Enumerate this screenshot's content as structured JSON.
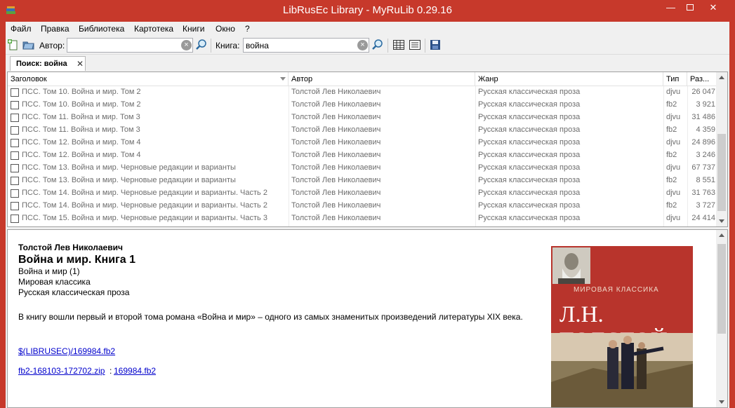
{
  "window": {
    "title": "LibRusEc Library - MyRuLib 0.29.16",
    "minimize_glyph": "—",
    "close_glyph": "✕"
  },
  "menu": [
    "Файл",
    "Правка",
    "Библиотека",
    "Картотека",
    "Книги",
    "Окно",
    "?"
  ],
  "toolbar": {
    "author_label": "Автор:",
    "author_value": "",
    "book_label": "Книга:",
    "book_value": "война",
    "clear_glyph": "×"
  },
  "tab": {
    "label": "Поиск: война",
    "close_glyph": "✕"
  },
  "columns": [
    "Заголовок",
    "Автор",
    "Жанр",
    "Тип",
    "Раз..."
  ],
  "rows": [
    {
      "title": "ПСС. Том 10. Война и мир. Том 2",
      "author": "Толстой Лев Николаевич",
      "genre": "Русская классическая проза",
      "type": "djvu",
      "size": "26 047"
    },
    {
      "title": "ПСС. Том 10. Война и мир. Том 2",
      "author": "Толстой Лев Николаевич",
      "genre": "Русская классическая проза",
      "type": "fb2",
      "size": "3 921"
    },
    {
      "title": "ПСС. Том 11. Война и мир. Том 3",
      "author": "Толстой Лев Николаевич",
      "genre": "Русская классическая проза",
      "type": "djvu",
      "size": "31 486"
    },
    {
      "title": "ПСС. Том 11. Война и мир. Том 3",
      "author": "Толстой Лев Николаевич",
      "genre": "Русская классическая проза",
      "type": "fb2",
      "size": "4 359"
    },
    {
      "title": "ПСС. Том 12. Война и мир. Том 4",
      "author": "Толстой Лев Николаевич",
      "genre": "Русская классическая проза",
      "type": "djvu",
      "size": "24 896"
    },
    {
      "title": "ПСС. Том 12. Война и мир. Том 4",
      "author": "Толстой Лев Николаевич",
      "genre": "Русская классическая проза",
      "type": "fb2",
      "size": "3 246"
    },
    {
      "title": "ПСС. Том 13. Война и мир. Черновые редакции и варианты",
      "author": "Толстой Лев Николаевич",
      "genre": "Русская классическая проза",
      "type": "djvu",
      "size": "67 737"
    },
    {
      "title": "ПСС. Том 13. Война и мир. Черновые редакции и варианты",
      "author": "Толстой Лев Николаевич",
      "genre": "Русская классическая проза",
      "type": "fb2",
      "size": "8 551"
    },
    {
      "title": "ПСС. Том 14. Война и мир. Черновые редакции и варианты. Часть 2",
      "author": "Толстой Лев Николаевич",
      "genre": "Русская классическая проза",
      "type": "djvu",
      "size": "31 763"
    },
    {
      "title": "ПСС. Том 14. Война и мир. Черновые редакции и варианты. Часть 2",
      "author": "Толстой Лев Николаевич",
      "genre": "Русская классическая проза",
      "type": "fb2",
      "size": "3 727"
    },
    {
      "title": "ПСС. Том 15. Война и мир. Черновые редакции и варианты. Часть 3",
      "author": "Толстой Лев Николаевич",
      "genre": "Русская классическая проза",
      "type": "djvu",
      "size": "24 414"
    }
  ],
  "detail": {
    "author": "Толстой Лев Николаевич",
    "title": "Война и мир. Книга 1",
    "series": "Война и мир (1)",
    "collection": "Мировая классика",
    "genre": "Русская классическая проза",
    "description": "В книгу вошли первый и второй тома романа «Война и мир» – одного из самых знаменитых произведений литературы XIX века.",
    "link_path": "$(LIBRUSEC)/169984.fb2",
    "archive": "fb2-168103-172702.zip",
    "archive_sep": ":",
    "archive_file": "169984.fb2"
  },
  "cover": {
    "series_text": "МИРОВАЯ КЛАССИКА",
    "author_text": "Л.Н. ТОЛСТОЙ"
  },
  "colors": {
    "titlebar": "#c7392b",
    "cover_red": "#b8342c",
    "link": "#0000cc"
  }
}
